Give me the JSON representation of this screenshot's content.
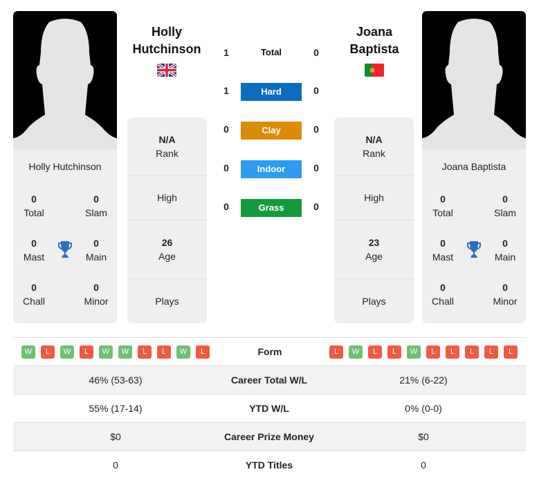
{
  "players": [
    {
      "name": "Holly Hutchinson",
      "name_line1": "Holly",
      "name_line2": "Hutchinson",
      "flag": "uk-flag",
      "rank": "N/A",
      "rank_label": "Rank",
      "high_label": "High",
      "age": "26",
      "age_label": "Age",
      "plays_label": "Plays",
      "titles": {
        "total": "0",
        "total_label": "Total",
        "slam": "0",
        "slam_label": "Slam",
        "mast": "0",
        "mast_label": "Mast",
        "main": "0",
        "main_label": "Main",
        "chall": "0",
        "chall_label": "Chall",
        "minor": "0",
        "minor_label": "Minor"
      },
      "form": [
        "W",
        "L",
        "W",
        "L",
        "W",
        "W",
        "L",
        "L",
        "W",
        "L"
      ],
      "career_total_wl": "46% (53-63)",
      "ytd_wl": "55% (17-14)",
      "career_prize_money": "$0",
      "ytd_titles": "0"
    },
    {
      "name": "Joana Baptista",
      "name_line1": "Joana",
      "name_line2": "Baptista",
      "flag": "portugal-flag",
      "rank": "N/A",
      "rank_label": "Rank",
      "high_label": "High",
      "age": "23",
      "age_label": "Age",
      "plays_label": "Plays",
      "titles": {
        "total": "0",
        "total_label": "Total",
        "slam": "0",
        "slam_label": "Slam",
        "mast": "0",
        "mast_label": "Mast",
        "main": "0",
        "main_label": "Main",
        "chall": "0",
        "chall_label": "Chall",
        "minor": "0",
        "minor_label": "Minor"
      },
      "form": [
        "L",
        "W",
        "L",
        "L",
        "W",
        "L",
        "L",
        "L",
        "L",
        "L"
      ],
      "career_total_wl": "21% (6-22)",
      "ytd_wl": "0% (0-0)",
      "career_prize_money": "$0",
      "ytd_titles": "0"
    }
  ],
  "h2h": [
    {
      "label": "Total",
      "left": "1",
      "right": "0",
      "color": ""
    },
    {
      "label": "Hard",
      "left": "1",
      "right": "0",
      "color": "#0a6dc2"
    },
    {
      "label": "Clay",
      "left": "0",
      "right": "0",
      "color": "#dd8a07"
    },
    {
      "label": "Indoor",
      "left": "0",
      "right": "0",
      "color": "#2b9cf2"
    },
    {
      "label": "Grass",
      "left": "0",
      "right": "0",
      "color": "#129a3c"
    }
  ],
  "stats_labels": {
    "form": "Form",
    "career_total_wl": "Career Total W/L",
    "ytd_wl": "YTD W/L",
    "career_prize_money": "Career Prize Money",
    "ytd_titles": "YTD Titles"
  },
  "colors": {
    "win": "#6fbf73",
    "loss": "#ee5a42",
    "trophy": "#2f6fc0"
  }
}
